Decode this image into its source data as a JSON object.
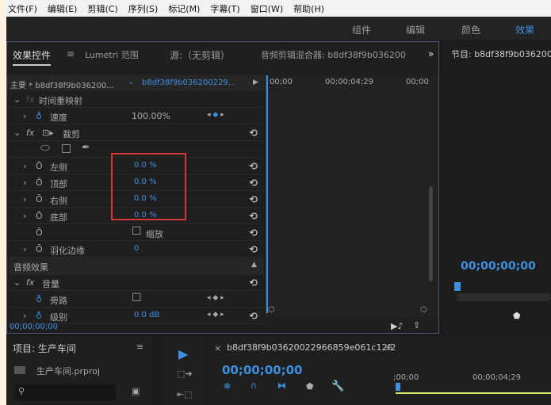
{
  "menu": [
    "文件(F)",
    "编辑(E)",
    "剪辑(C)",
    "序列(S)",
    "标记(M)",
    "字幕(T)",
    "窗口(W)",
    "帮助(H)"
  ],
  "workspaces": [
    "组件",
    "编辑",
    "颜色",
    "效果"
  ],
  "effect_controls": {
    "tabs": [
      "效果控件",
      "Lumetri 范围",
      "源:（无剪辑）",
      "音频剪辑混合器: b8df38f9b036200"
    ],
    "overflow": "»",
    "master": "主要 * b8df38f9b036200...",
    "clip": "b8df38f9b036200229...",
    "ruler": [
      "00;00",
      "00;00;04;29",
      "00;00"
    ],
    "time_remap": "时间重映射",
    "speed_label": "速度",
    "speed_value": "100.00%",
    "crop": "裁剪",
    "params": [
      {
        "label": "左侧",
        "value": "0.0 %"
      },
      {
        "label": "顶部",
        "value": "0.0 %"
      },
      {
        "label": "右侧",
        "value": "0.0 %"
      },
      {
        "label": "底部",
        "value": "0.0 %"
      }
    ],
    "zoom_label": "缩放",
    "feather_label": "羽化边缘",
    "feather_value": "0",
    "audio_effects": "音频效果",
    "volume": "音量",
    "bypass": "旁路",
    "level_label": "级别",
    "level_value": "0.0 dB",
    "timecode": "00;00;00;00",
    "highlight_color": "#d03a3a"
  },
  "program": {
    "title": "节目: b8df38f9b036200",
    "timecode": "00;00;00;00"
  },
  "project": {
    "title": "项目: 生产车间",
    "file": "生产车间.prproj"
  },
  "timeline": {
    "sequence": "b8df38f9b03620022966859e061c12f2",
    "timecode": "00;00;00;00",
    "ruler": [
      ";00;00",
      "00;00;04;29"
    ]
  }
}
